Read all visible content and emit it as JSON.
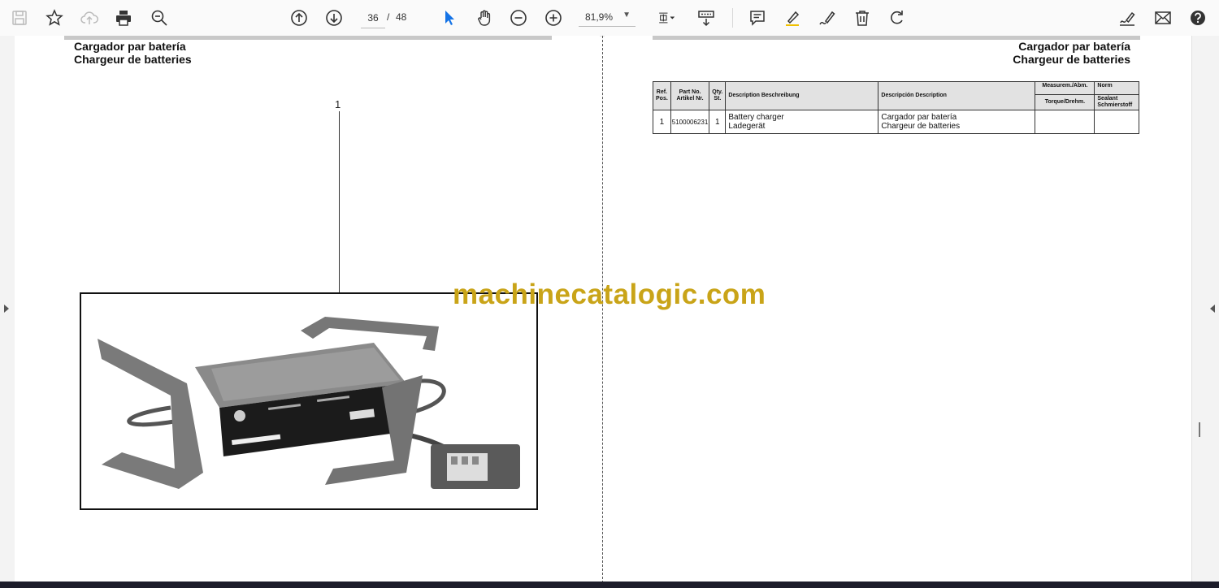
{
  "toolbar": {
    "page_current": "36",
    "page_separator": "/",
    "page_total": "48",
    "zoom": "81,9%",
    "icons": [
      "save-icon",
      "bookmark-star-icon",
      "cloud-upload-icon",
      "print-icon",
      "find-zoom-icon",
      "page-up-icon",
      "page-down-icon",
      "select-cursor-icon",
      "hand-tool-icon",
      "zoom-out-icon",
      "zoom-in-icon",
      "fit-page-icon",
      "scroll-mode-icon",
      "comment-icon",
      "highlight-pen-icon",
      "draw-sign-icon",
      "delete-icon",
      "rotate-icon",
      "fill-sign-icon",
      "email-icon",
      "help-icon"
    ]
  },
  "left_page": {
    "header_line1": "Cargador par batería",
    "header_line2": "Chargeur de batteries",
    "callout_label": "1",
    "photo_alt": "Battery charger photo"
  },
  "right_page": {
    "header_line1": "Cargador par batería",
    "header_line2": "Chargeur de batteries",
    "table": {
      "headers": {
        "ref": "Ref. Pos.",
        "part": "Part No. Artikel Nr.",
        "qty": "Qty. St.",
        "desc_en": "Description Beschreibung",
        "desc_es": "Descripción Description",
        "measure": "Measurem./Abm.",
        "norm": "Norm",
        "torque": "Torque/Drehm.",
        "sealant": "Sealant Schmierstoff"
      },
      "rows": [
        {
          "ref": "1",
          "part": "5100006231",
          "qty": "1",
          "desc_en_1": "Battery charger",
          "desc_en_2": "Ladegerät",
          "desc_es_1": "Cargador par batería",
          "desc_es_2": "Chargeur de batteries",
          "torque": "",
          "sealant": ""
        }
      ]
    }
  },
  "watermark": "machinecatalogic.com",
  "colors": {
    "watermark": "#c9a418",
    "accent_blue": "#1473e6"
  }
}
